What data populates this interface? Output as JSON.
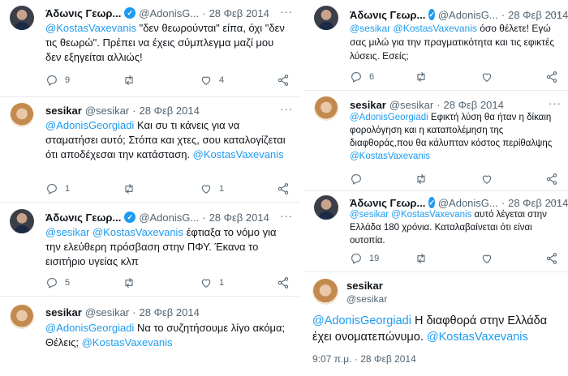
{
  "left": [
    {
      "name": "Άδωνις Γεωρ...",
      "handle": "@AdonisG...",
      "date": "28 Φεβ 2014",
      "avatar": "adonis",
      "verified": true,
      "text_parts": [
        "@KostasVaxevanis",
        " \"δεν θεωρούνται\" είπα, όχι \"δεν τις θεωρώ\". Πρέπει να έχεις σύμπλεγμα μαζί μου δεν εξηγείται αλλιώς!"
      ],
      "replies": "9",
      "retweets": "",
      "likes": "4"
    },
    {
      "name": "sesikar",
      "handle": "@sesikar",
      "date": "28 Φεβ 2014",
      "avatar": "sesikar",
      "verified": false,
      "text_parts": [
        "@AdonisGeorgiadi",
        " Και συ τι κάνεις για να σταματήσει αυτό; Στόπα και χτες, σου καταλογίζεται ότι αποδέχεσαι την κατάσταση. ",
        "@KostasVaxevanis"
      ],
      "replies": "1",
      "retweets": "",
      "likes": "1"
    },
    {
      "name": "Άδωνις Γεωρ...",
      "handle": "@AdonisG...",
      "date": "28 Φεβ 2014",
      "avatar": "adonis",
      "verified": true,
      "text_parts": [
        "@sesikar @KostasVaxevanis",
        " έφτιαξα το νόμο για την ελεύθερη πρόσβαση στην ΠΦΥ. Έκανα το εισιτήριο υγείας κλπ"
      ],
      "replies": "5",
      "retweets": "",
      "likes": "1"
    },
    {
      "name": "sesikar",
      "handle": "@sesikar",
      "date": "28 Φεβ 2014",
      "avatar": "sesikar",
      "verified": false,
      "text_parts": [
        "@AdonisGeorgiadi",
        " Να το συζητήσουμε λίγο ακόμα; Θέλεις; ",
        "@KostasVaxevanis"
      ]
    }
  ],
  "right": [
    {
      "name": "Άδωνις Γεωρ...",
      "handle": "@AdonisG...",
      "date": "28 Φεβ 2014",
      "avatar": "adonis",
      "verified": true,
      "text_parts": [
        "@sesikar @KostasVaxevanis",
        " όσο θέλετε! Εγώ σας μιλώ για την πραγματικότητα και τις εφικτές λύσεις. Εσείς;"
      ],
      "replies": "6",
      "retweets": "",
      "likes": ""
    },
    {
      "name": "sesikar",
      "handle": "@sesikar",
      "date": "28 Φεβ 2014",
      "avatar": "sesikar",
      "verified": false,
      "text_parts": [
        "@AdonisGeorgiadi",
        " Εφικτή λύση θα ήταν η δίκαιη φορολόγηση και η καταπολέμηση της διαφθοράς,που θα κάλυπταν κόστος περίθαλψης ",
        "@KostasVaxevanis"
      ],
      "replies": "",
      "retweets": "",
      "likes": ""
    },
    {
      "name": "Άδωνις Γεωρ...",
      "handle": "@AdonisG...",
      "date": "28 Φεβ 2014",
      "avatar": "adonis",
      "verified": true,
      "text_parts": [
        "@sesikar @KostasVaxevanis",
        " αυτό λέγεται στην Ελλάδα 180 χρόνια. Καταλαβαίνεται ότι είναι ουτοπία."
      ],
      "replies": "19",
      "retweets": "",
      "likes": ""
    }
  ],
  "focus": {
    "name": "sesikar",
    "handle": "@sesikar",
    "text_parts": [
      "@AdonisGeorgiadi",
      " Η διαφθορά στην Ελλάδα έχει ονοματεπώνυμο. ",
      "@KostasVaxevanis"
    ],
    "time": "9:07 π.μ. · 28 Φεβ 2014"
  },
  "icons": {
    "verified": "verified-badge-icon",
    "more": "more-options-icon",
    "reply": "reply-icon",
    "retweet": "retweet-icon",
    "like": "heart-icon",
    "share": "share-icon"
  },
  "colors": {
    "accent": "#1d9bf0",
    "text": "#0f1419",
    "muted": "#536471",
    "divider": "#e6ecf0"
  },
  "symbols": {
    "dot": "·",
    "more": "···",
    "check": "✓"
  }
}
